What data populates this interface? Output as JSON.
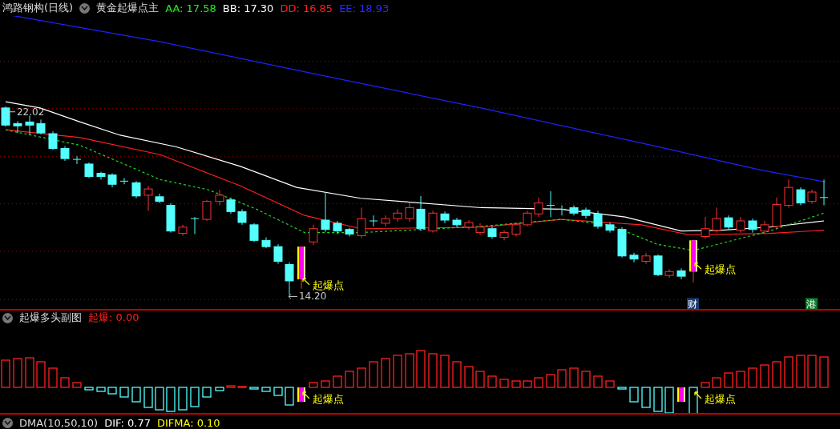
{
  "header": {
    "title": "鸿路钢构(日线)",
    "indicator": "黄金起爆点主",
    "values": [
      {
        "label": "AA: 17.58",
        "color": "#22ee22"
      },
      {
        "label": "BB: 17.30",
        "color": "#ffffff"
      },
      {
        "label": "DD: 16.85",
        "color": "#ff2020"
      },
      {
        "label": "EE: 18.93",
        "color": "#2a2aff"
      }
    ]
  },
  "main_chart": {
    "high_label": "22.02",
    "low_label": "14.20",
    "signals": [
      "起爆点",
      "起爆点"
    ],
    "badges": [
      {
        "text": "财",
        "color": "#1a3c6e"
      },
      {
        "text": "港",
        "color": "#0a7a2a"
      }
    ]
  },
  "sub_chart": {
    "title": "起爆多头副图",
    "reading": "起爆: 0.00",
    "signals": [
      "起爆点",
      "起爆点"
    ]
  },
  "bottom_panel": {
    "title": "DMA(10,50,10)",
    "values": [
      {
        "label": "DIF: 0.77",
        "color": "#ffffff"
      },
      {
        "label": "DIFMA: 0.10",
        "color": "#ffff00"
      }
    ]
  }
}
